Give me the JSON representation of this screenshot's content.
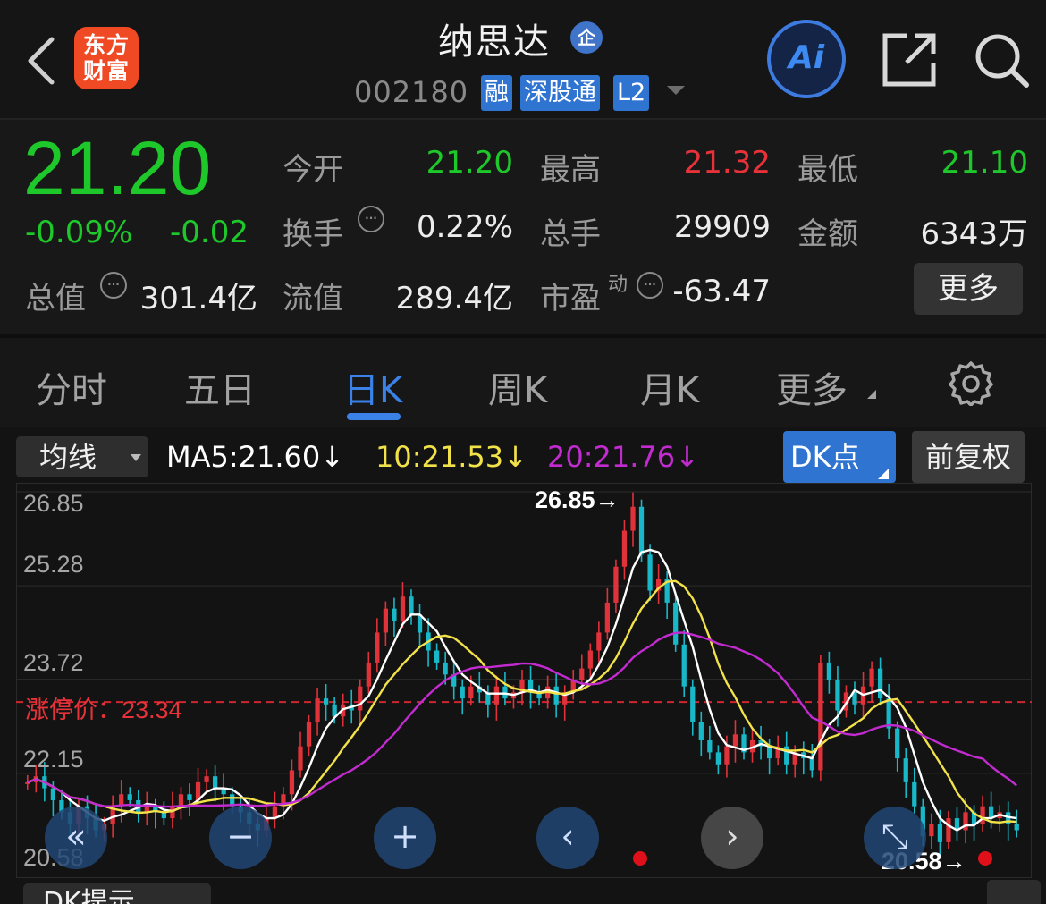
{
  "header": {
    "logo_line1": "东方",
    "logo_line2": "财富",
    "stock_name": "纳思达",
    "qi_badge": "企",
    "stock_code": "002180",
    "tags": [
      "融",
      "深股通",
      "L2"
    ],
    "ai_label": "Ai"
  },
  "quote": {
    "price": "21.20",
    "change_pct": "-0.09%",
    "change_abs": "-0.02",
    "open_label": "今开",
    "open": "21.20",
    "high_label": "最高",
    "high": "21.32",
    "low_label": "最低",
    "low": "21.10",
    "turnover_label": "换手",
    "turnover": "0.22%",
    "volume_label": "总手",
    "volume": "29909",
    "amount_label": "金额",
    "amount": "6343万",
    "mktcap_label": "总值",
    "mktcap": "301.4亿",
    "float_label": "流值",
    "float_cap": "289.4亿",
    "pe_label": "市盈",
    "pe_sup": "动",
    "pe": "-63.47",
    "more_label": "更多",
    "colors": {
      "down": "#1ec72a",
      "up": "#e8323a"
    }
  },
  "tabs": {
    "items": [
      "分时",
      "五日",
      "日K",
      "周K",
      "月K",
      "更多"
    ],
    "active": "日K"
  },
  "toolbar": {
    "ma_select": "均线",
    "ma5": "MA5:21.60↓",
    "ma10": "10:21.53↓",
    "ma20": "20:21.76↓",
    "dk_button": "DK点",
    "fq_button": "前复权",
    "ma_colors": {
      "ma5": "#ffffff",
      "ma10": "#f2e24a",
      "ma20": "#c22bd0"
    }
  },
  "chart": {
    "y_labels": [
      "26.85",
      "25.28",
      "23.72",
      "22.15",
      "20.58"
    ],
    "limit_label": "涨停价：23.34",
    "high_marker": "26.85→",
    "low_marker": "20.58→",
    "watermark": "东方财富"
  },
  "chart_data": {
    "type": "candlestick",
    "ylim": [
      20.58,
      26.85
    ],
    "max_price": 26.85,
    "min_price": 20.58,
    "limit_up_price": 23.34,
    "ma_last": {
      "MA5": 21.6,
      "MA10": 21.53,
      "MA20": 21.76
    },
    "closes": [
      22.0,
      22.1,
      21.9,
      21.7,
      21.5,
      21.3,
      21.6,
      21.4,
      21.2,
      21.3,
      21.6,
      21.8,
      21.7,
      21.5,
      21.6,
      21.5,
      21.4,
      21.6,
      21.8,
      21.7,
      22.0,
      22.1,
      21.9,
      21.8,
      21.6,
      21.5,
      21.3,
      21.2,
      21.4,
      21.6,
      21.8,
      22.2,
      22.6,
      23.0,
      23.4,
      23.3,
      23.1,
      23.3,
      23.2,
      23.6,
      24.0,
      24.5,
      24.9,
      24.7,
      25.1,
      24.8,
      24.5,
      24.2,
      24.0,
      23.8,
      23.6,
      23.4,
      23.6,
      23.5,
      23.3,
      23.6,
      23.4,
      23.5,
      23.7,
      23.5,
      23.4,
      23.6,
      23.3,
      23.5,
      23.7,
      23.9,
      24.2,
      24.5,
      25.0,
      25.6,
      26.2,
      26.6,
      25.8,
      25.2,
      25.4,
      25.0,
      24.3,
      23.6,
      23.0,
      22.7,
      22.5,
      22.3,
      22.6,
      22.8,
      22.5,
      22.7,
      22.6,
      22.4,
      22.6,
      22.3,
      22.5,
      22.4,
      22.2,
      24.0,
      23.7,
      23.2,
      23.5,
      23.3,
      23.6,
      23.9,
      23.4,
      22.9,
      22.4,
      22.0,
      21.6,
      21.1,
      21.3,
      21.0,
      21.4,
      21.2,
      21.5,
      21.3,
      21.6,
      21.4,
      21.5,
      21.3,
      21.2
    ]
  },
  "controls": {
    "first": "«",
    "zoom_out": "−",
    "zoom_in": "+",
    "prev": "‹",
    "next": "›",
    "fullscreen": "⤡"
  },
  "bottom": {
    "dk_hint": "DK提示"
  }
}
